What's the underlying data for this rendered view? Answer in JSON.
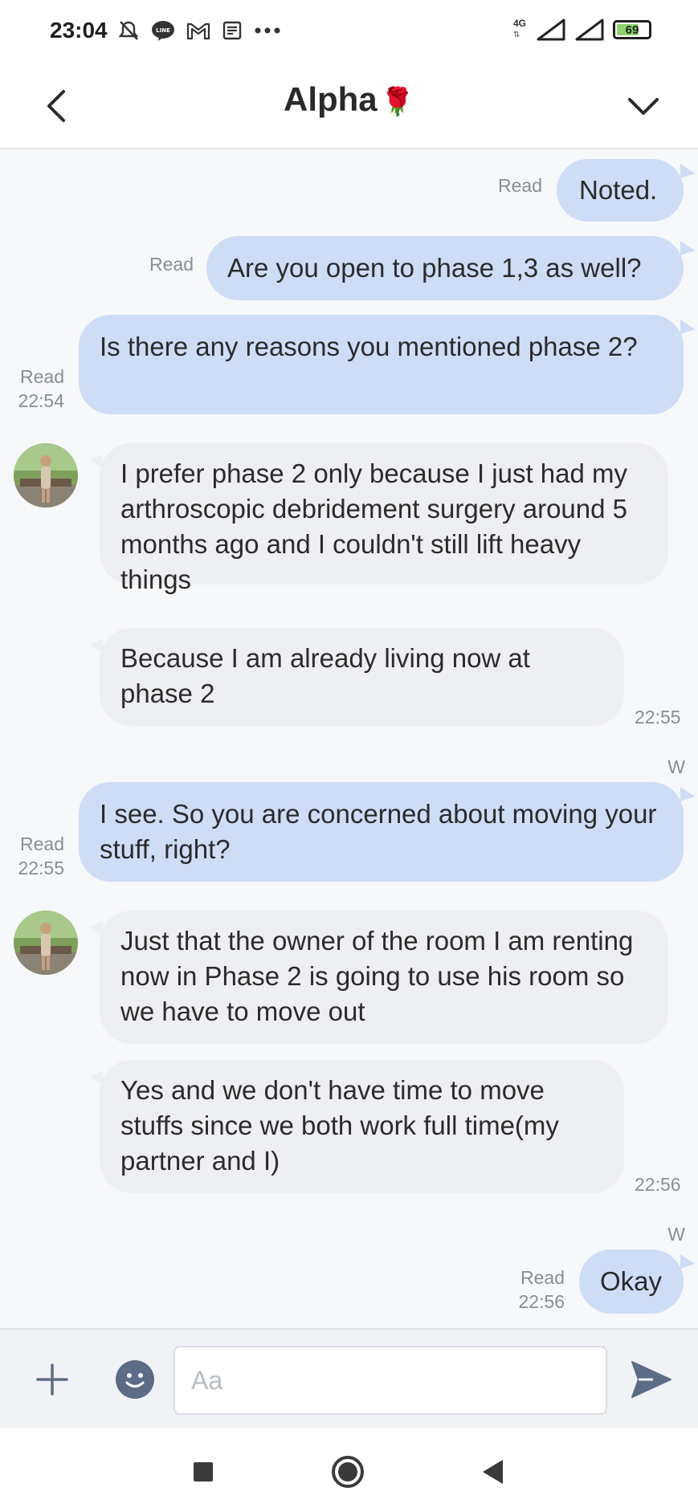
{
  "status_bar": {
    "time": "23:04",
    "network": "4G",
    "battery": "69",
    "icons": [
      "mute-icon",
      "line-app-icon",
      "gmail-icon",
      "news-icon",
      "more-dots-icon",
      "signal-icon",
      "signal-icon",
      "battery-icon"
    ]
  },
  "header": {
    "title": "Alpha",
    "title_emoji": "🌹",
    "back_icon": "chevron-left-icon",
    "menu_icon": "chevron-down-icon"
  },
  "messages": [
    {
      "direction": "out",
      "text": "Noted.",
      "meta": "Read"
    },
    {
      "direction": "out",
      "text": "Are you open to phase 1,3 as well?",
      "meta": "Read"
    },
    {
      "direction": "out",
      "text": "Is there any reasons you mentioned phase 2?",
      "meta": "Read",
      "time": "22:54"
    },
    {
      "direction": "in",
      "text": "I prefer phase 2 only because I just had my arthroscopic debridement surgery around 5 months ago and I couldn't still lift heavy things"
    },
    {
      "direction": "in",
      "text": "Because I am already living now at phase 2",
      "time": "22:55"
    },
    {
      "direction": "out",
      "above": "W",
      "text": "I see. So you are concerned about moving your stuff, right?",
      "meta": "Read",
      "time": "22:55"
    },
    {
      "direction": "in",
      "text": "Just that the owner of the room I am renting now in Phase 2 is going to use his room so we have to move out"
    },
    {
      "direction": "in",
      "text": "Yes and we don't have time to move stuffs since we both work full time(my partner and I)",
      "time": "22:56"
    },
    {
      "direction": "out",
      "above": "W",
      "text": "Okay",
      "meta": "Read",
      "time": "22:56"
    }
  ],
  "input": {
    "placeholder": "Aa",
    "value": ""
  },
  "colors": {
    "outgoing_bubble": "#cfdcf5",
    "incoming_bubble": "#eeeff2",
    "meta_text": "#8a8d93",
    "icon_dark": "#5e6b86"
  }
}
